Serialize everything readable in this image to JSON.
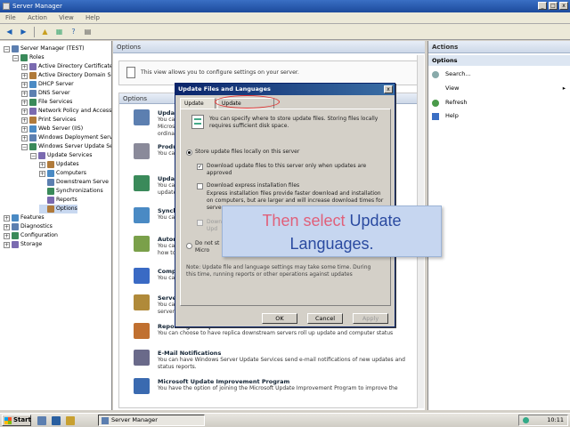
{
  "window": {
    "title": "Server Manager"
  },
  "menu": [
    "File",
    "Action",
    "View",
    "Help"
  ],
  "tree": {
    "nodes": [
      {
        "label": "Server Manager (TEST)",
        "indent": 0,
        "expander": "−"
      },
      {
        "label": "Roles",
        "indent": 1,
        "expander": "−"
      },
      {
        "label": "Active Directory Certificate",
        "indent": 2,
        "expander": "+"
      },
      {
        "label": "Active Directory Domain Se",
        "indent": 2,
        "expander": "+"
      },
      {
        "label": "DHCP Server",
        "indent": 2,
        "expander": "+"
      },
      {
        "label": "DNS Server",
        "indent": 2,
        "expander": "+"
      },
      {
        "label": "File Services",
        "indent": 2,
        "expander": "+"
      },
      {
        "label": "Network Policy and Access",
        "indent": 2,
        "expander": "+"
      },
      {
        "label": "Print Services",
        "indent": 2,
        "expander": "+"
      },
      {
        "label": "Web Server (IIS)",
        "indent": 2,
        "expander": "+"
      },
      {
        "label": "Windows Deployment Servi",
        "indent": 2,
        "expander": "+"
      },
      {
        "label": "Windows Server Update Se",
        "indent": 2,
        "expander": "−"
      },
      {
        "label": "Update Services",
        "indent": 3,
        "expander": "−"
      },
      {
        "label": "Updates",
        "indent": 4,
        "expander": "+"
      },
      {
        "label": "Computers",
        "indent": 4,
        "expander": "+"
      },
      {
        "label": "Downstream Serve",
        "indent": 4,
        "expander": ""
      },
      {
        "label": "Synchronizations",
        "indent": 4,
        "expander": ""
      },
      {
        "label": "Reports",
        "indent": 4,
        "expander": ""
      },
      {
        "label": "Options",
        "indent": 4,
        "expander": "",
        "selected": true
      },
      {
        "label": "Features",
        "indent": 0,
        "expander": "+"
      },
      {
        "label": "Diagnostics",
        "indent": 0,
        "expander": "+"
      },
      {
        "label": "Configuration",
        "indent": 0,
        "expander": "+"
      },
      {
        "label": "Storage",
        "indent": 0,
        "expander": "+"
      }
    ]
  },
  "center": {
    "header": "Options",
    "info": "This view allows you to configure settings on your server.",
    "options_header": "Options",
    "items": [
      {
        "title": "Update",
        "desc1": "You can",
        "desc2": "Microsof",
        "desc3": "ordinat"
      },
      {
        "title": "Produc",
        "desc1": "You can",
        "desc2": "",
        "desc3": ""
      },
      {
        "title": "Update",
        "desc1": "You can",
        "desc2": "updates",
        "desc3": ""
      },
      {
        "title": "Synchr",
        "desc1": "You can",
        "desc2": "",
        "desc3": ""
      },
      {
        "title": "Autom",
        "desc1": "You can",
        "desc2": "how to s",
        "desc3": ""
      },
      {
        "title": "Comput",
        "desc1": "You can",
        "desc2": "",
        "desc3": ""
      },
      {
        "title": "Server",
        "desc1": "You can",
        "desc2": "server.",
        "desc3": ""
      },
      {
        "title": "Reporting Rollup",
        "desc1": "You can choose to have replica downstream servers roll up update and computer status",
        "desc2": "",
        "desc3": ""
      },
      {
        "title": "E-Mail Notifications",
        "desc1": "You can have Windows Server Update Services send e-mail notifications of new updates and",
        "desc2": "status reports.",
        "desc3": ""
      },
      {
        "title": "Microsoft Update Improvement Program",
        "desc1": "You have the option of joining the Microsoft Update Improvement Program to improve the",
        "desc2": "",
        "desc3": ""
      }
    ]
  },
  "actions": {
    "header": "Actions",
    "section": "Options",
    "items": [
      "Search...",
      "View",
      "Refresh",
      "Help"
    ]
  },
  "dialog": {
    "title": "Update Files and Languages",
    "close": "x",
    "tabs": [
      "Update Files",
      "Update Languages"
    ],
    "intro1": "You can specify where to store update files. Storing files locally",
    "intro2": "requires sufficient disk space.",
    "radio_local": "Store update files locally on this server",
    "chk_approved1": "Download update files to this server only when updates are",
    "chk_approved2": "approved",
    "chk_express": "Download express installation files",
    "express1": "Express installation files provide faster download and installation",
    "express2": "on computers, but are larger and will increase download times for",
    "express3": "servers.",
    "chk_grey1": "Downl",
    "chk_grey2": "Upd",
    "radio_nostore1": "Do not st",
    "radio_nostore2": "Micro",
    "note1": "Note: Update file and language settings may take some time. During",
    "note2": "this time, running reports or other operations against updates",
    "note3": "",
    "ok": "OK",
    "cancel": "Cancel",
    "apply": "Apply"
  },
  "callout": {
    "line1a": "Then select ",
    "line1b": "Update",
    "line2": "Languages."
  },
  "taskbar": {
    "start": "Start",
    "task": "Server Manager",
    "clock": "10:11"
  }
}
